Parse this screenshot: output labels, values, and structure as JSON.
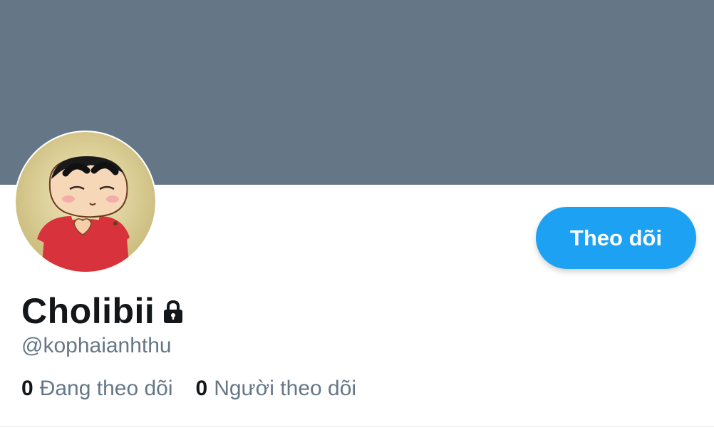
{
  "colors": {
    "banner": "#657786",
    "accent": "#1da1f2",
    "text_primary": "#14171a",
    "text_secondary": "#657786"
  },
  "profile": {
    "display_name": "Cholibii",
    "handle": "@kophaianhthu",
    "protected": true,
    "avatar_icon": "cartoon-avatar"
  },
  "actions": {
    "follow_label": "Theo dõi"
  },
  "stats": {
    "following_count": "0",
    "following_label": "Đang theo dõi",
    "followers_count": "0",
    "followers_label": "Người theo dõi"
  }
}
